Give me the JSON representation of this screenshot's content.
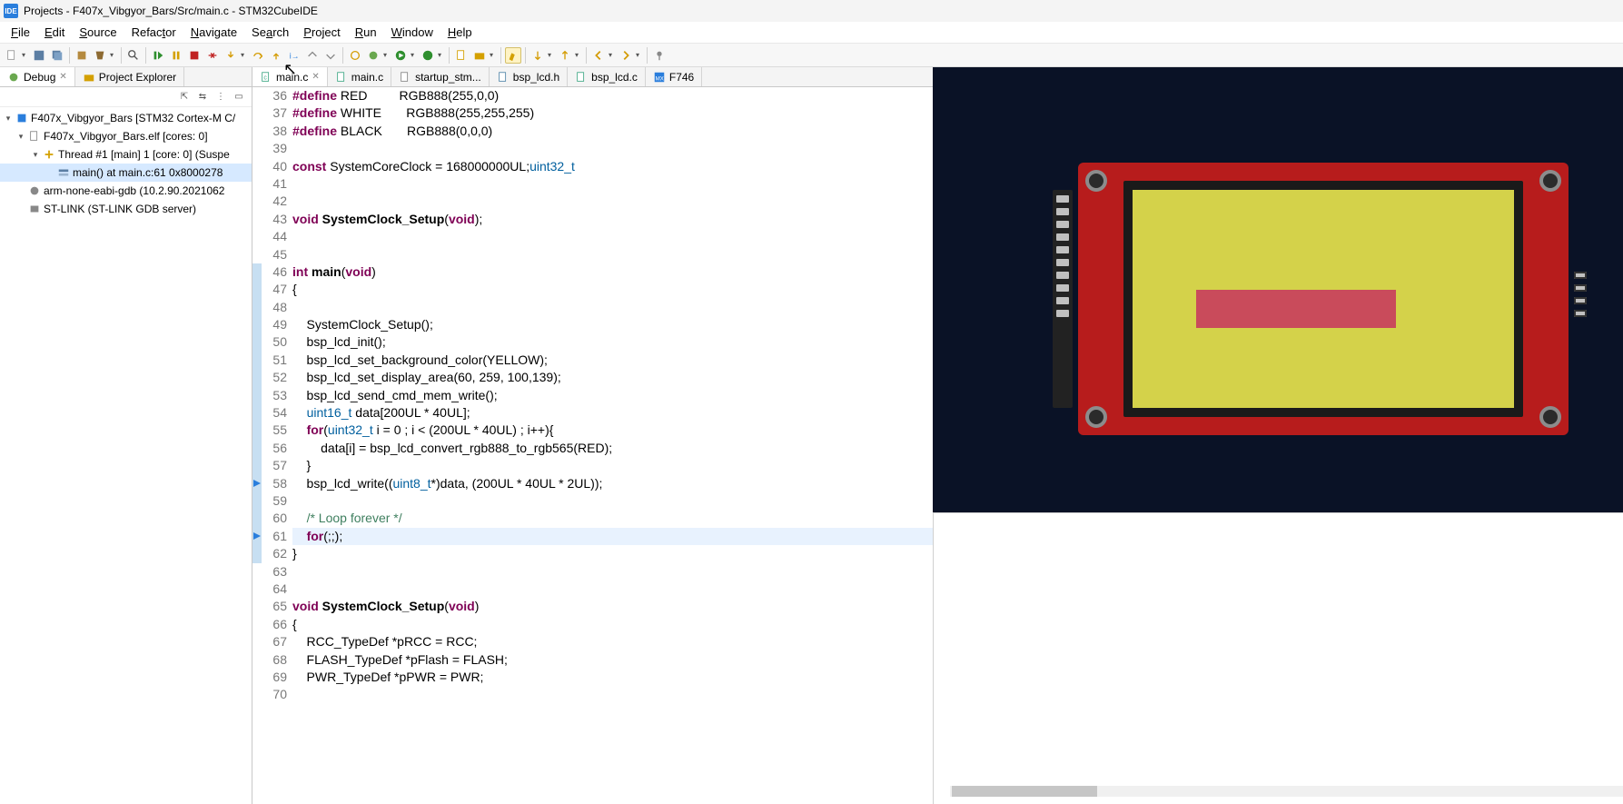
{
  "title": "Projects - F407x_Vibgyor_Bars/Src/main.c - STM32CubeIDE",
  "menu": {
    "file": "File",
    "edit": "Edit",
    "source": "Source",
    "refactor": "Refactor",
    "navigate": "Navigate",
    "search": "Search",
    "project": "Project",
    "run": "Run",
    "window": "Window",
    "help": "Help"
  },
  "left_tabs": {
    "debug": "Debug",
    "project_explorer": "Project Explorer"
  },
  "debug_tree": {
    "root": "F407x_Vibgyor_Bars [STM32 Cortex-M C/",
    "elf": "F407x_Vibgyor_Bars.elf [cores: 0]",
    "thread": "Thread #1 [main] 1 [core: 0] (Suspe",
    "frame": "main() at main.c:61 0x8000278",
    "gdb": "arm-none-eabi-gdb (10.2.90.2021062",
    "stlink": "ST-LINK (ST-LINK GDB server)"
  },
  "editor_tabs": {
    "t1": "main.c",
    "t2": "main.c",
    "t3": "startup_stm...",
    "t4": "bsp_lcd.h",
    "t5": "bsp_lcd.c",
    "t6": "F746"
  },
  "code": {
    "lines": [
      {
        "n": 36,
        "pre": "#define ",
        "id": "RED",
        "rest": "         RGB888(255,0,0)"
      },
      {
        "n": 37,
        "pre": "#define ",
        "id": "WHITE",
        "rest": "       RGB888(255,255,255)"
      },
      {
        "n": 38,
        "pre": "#define ",
        "id": "BLACK",
        "rest": "       RGB888(0,0,0)"
      },
      {
        "n": 39,
        "plain": ""
      },
      {
        "n": 40,
        "kw": "const ",
        "ty": "uint32_t ",
        "plain2": "SystemCoreClock = 168000000UL;"
      },
      {
        "n": 41,
        "plain": ""
      },
      {
        "n": 42,
        "plain": ""
      },
      {
        "n": 43,
        "kw": "void ",
        "fn": "SystemClock_Setup",
        "sig": "(",
        "kw2": "void",
        "sig2": ");"
      },
      {
        "n": 44,
        "plain": ""
      },
      {
        "n": 45,
        "plain": ""
      },
      {
        "n": 46,
        "kw": "int ",
        "fn": "main",
        "sig": "(",
        "kw2": "void",
        "sig2": ")"
      },
      {
        "n": 47,
        "plain": "{"
      },
      {
        "n": 48,
        "plain": ""
      },
      {
        "n": 49,
        "plain": "    SystemClock_Setup();"
      },
      {
        "n": 50,
        "plain": "    bsp_lcd_init();"
      },
      {
        "n": 51,
        "plain": "    bsp_lcd_set_background_color(YELLOW);"
      },
      {
        "n": 52,
        "plain": "    bsp_lcd_set_display_area(60, 259, 100,139);"
      },
      {
        "n": 53,
        "plain": "    bsp_lcd_send_cmd_mem_write();"
      },
      {
        "n": 54,
        "pre2": "    ",
        "ty": "uint16_t ",
        "plain2": "data[200UL * 40UL];"
      },
      {
        "n": 55,
        "pre2": "    ",
        "kw": "for",
        "plain2": "(",
        "ty": "uint32_t ",
        "plain3": "i = 0 ; i < (200UL * 40UL) ; i++){"
      },
      {
        "n": 56,
        "plain": "        data[i] = bsp_lcd_convert_rgb888_to_rgb565(RED);"
      },
      {
        "n": 57,
        "plain": "    }"
      },
      {
        "n": 58,
        "pre2": "    bsp_lcd_write((",
        "ty": "uint8_t",
        "plain2": "*)data, (200UL * 40UL * 2UL));"
      },
      {
        "n": 59,
        "plain": ""
      },
      {
        "n": 60,
        "pre2": "    ",
        "cm": "/* Loop forever */"
      },
      {
        "n": 61,
        "pre2": "    ",
        "kw": "for",
        "plain2": "(;;);",
        "hl": true
      },
      {
        "n": 62,
        "plain": "}"
      },
      {
        "n": 63,
        "plain": ""
      },
      {
        "n": 64,
        "plain": ""
      },
      {
        "n": 65,
        "kw": "void ",
        "fn": "SystemClock_Setup",
        "sig": "(",
        "kw2": "void",
        "sig2": ")"
      },
      {
        "n": 66,
        "plain": "{"
      },
      {
        "n": 67,
        "plain": "    RCC_TypeDef *pRCC = RCC;"
      },
      {
        "n": 68,
        "plain": "    FLASH_TypeDef *pFlash = FLASH;"
      },
      {
        "n": 69,
        "plain": "    PWR_TypeDef *pPWR = PWR;"
      },
      {
        "n": 70,
        "plain": ""
      }
    ],
    "bars": [
      46,
      47,
      48,
      49,
      50,
      51,
      52,
      53,
      54,
      55,
      56,
      57,
      58,
      59,
      60,
      61,
      62
    ],
    "markers": [
      58,
      61
    ]
  }
}
